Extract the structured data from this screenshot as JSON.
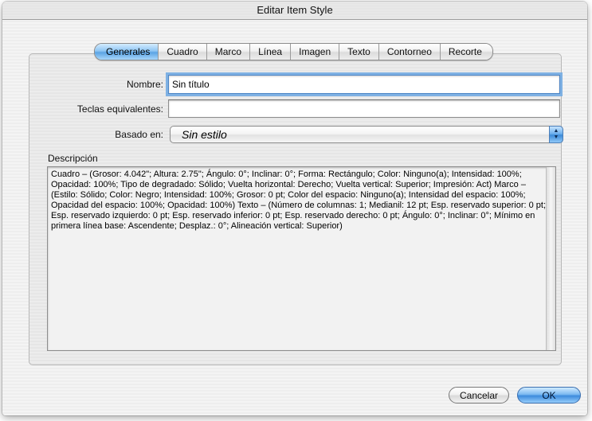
{
  "window": {
    "title": "Editar Item Style"
  },
  "tabs": [
    {
      "label": "Generales",
      "active": true
    },
    {
      "label": "Cuadro",
      "active": false
    },
    {
      "label": "Marco",
      "active": false
    },
    {
      "label": "Línea",
      "active": false
    },
    {
      "label": "Imagen",
      "active": false
    },
    {
      "label": "Texto",
      "active": false
    },
    {
      "label": "Contorneo",
      "active": false
    },
    {
      "label": "Recorte",
      "active": false
    }
  ],
  "form": {
    "nombre_label": "Nombre:",
    "nombre_value": "Sin título",
    "teclas_label": "Teclas equivalentes:",
    "teclas_value": "",
    "basado_label": "Basado en:",
    "basado_value": "Sin estilo"
  },
  "description": {
    "label": "Descripción",
    "text": "Cuadro – (Grosor: 4.042\"; Altura: 2.75\"; Ángulo: 0°; Inclinar: 0°; Forma: Rectángulo; Color: Ninguno(a); Intensidad: 100%; Opacidad: 100%; Tipo de degradado: Sólido; Vuelta horizontal: Derecho; Vuelta vertical: Superior; Impresión: Act) Marco – (Estilo: Sólido; Color: Negro; Intensidad: 100%; Grosor: 0 pt; Color del espacio: Ninguno(a); Intensidad del espacio: 100%; Opacidad del espacio: 100%; Opacidad: 100%) Texto – (Número de columnas: 1; Medianil: 12 pt; Esp. reservado superior: 0 pt; Esp. reservado izquierdo: 0 pt; Esp. reservado inferior: 0 pt; Esp. reservado derecho: 0 pt; Ángulo: 0°; Inclinar: 0°; Mínimo en primera línea base: Ascendente; Desplaz.: 0°; Alineación vertical: Superior)"
  },
  "buttons": {
    "cancel_label": "Cancelar",
    "ok_label": "OK"
  }
}
